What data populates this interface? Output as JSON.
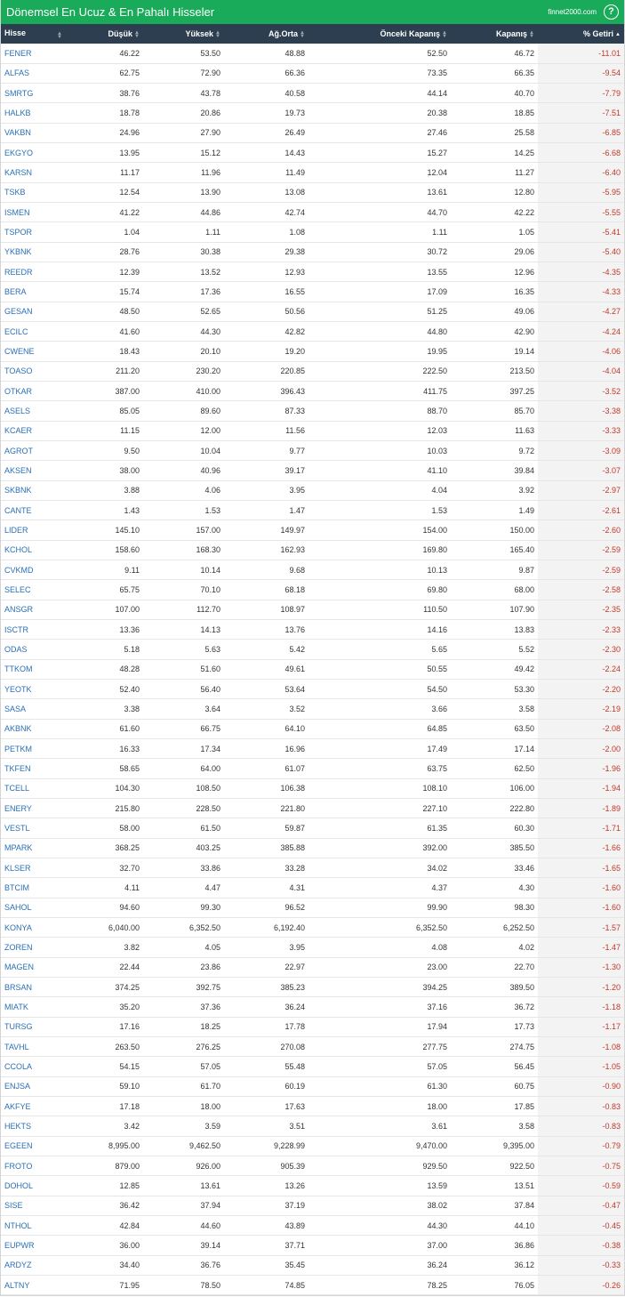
{
  "header": {
    "title": "Dönemsel En Ucuz & En Pahalı Hisseler",
    "brand": "finnet2000.com",
    "help_label": "?"
  },
  "colors": {
    "header_bg": "#1aab5a",
    "table_header_bg": "#2d3e50",
    "symbol": "#2a6fb5",
    "negative": "#c0392b"
  },
  "columns": [
    "Hisse",
    "Düşük",
    "Yüksek",
    "Ağ.Orta",
    "Önceki Kapanış",
    "Kapanış",
    "% Getiri"
  ],
  "rows": [
    [
      "FENER",
      "46.22",
      "53.50",
      "48.88",
      "52.50",
      "46.72",
      "-11.01"
    ],
    [
      "ALFAS",
      "62.75",
      "72.90",
      "66.36",
      "73.35",
      "66.35",
      "-9.54"
    ],
    [
      "SMRTG",
      "38.76",
      "43.78",
      "40.58",
      "44.14",
      "40.70",
      "-7.79"
    ],
    [
      "HALKB",
      "18.78",
      "20.86",
      "19.73",
      "20.38",
      "18.85",
      "-7.51"
    ],
    [
      "VAKBN",
      "24.96",
      "27.90",
      "26.49",
      "27.46",
      "25.58",
      "-6.85"
    ],
    [
      "EKGYO",
      "13.95",
      "15.12",
      "14.43",
      "15.27",
      "14.25",
      "-6.68"
    ],
    [
      "KARSN",
      "11.17",
      "11.96",
      "11.49",
      "12.04",
      "11.27",
      "-6.40"
    ],
    [
      "TSKB",
      "12.54",
      "13.90",
      "13.08",
      "13.61",
      "12.80",
      "-5.95"
    ],
    [
      "ISMEN",
      "41.22",
      "44.86",
      "42.74",
      "44.70",
      "42.22",
      "-5.55"
    ],
    [
      "TSPOR",
      "1.04",
      "1.11",
      "1.08",
      "1.11",
      "1.05",
      "-5.41"
    ],
    [
      "YKBNK",
      "28.76",
      "30.38",
      "29.38",
      "30.72",
      "29.06",
      "-5.40"
    ],
    [
      "REEDR",
      "12.39",
      "13.52",
      "12.93",
      "13.55",
      "12.96",
      "-4.35"
    ],
    [
      "BERA",
      "15.74",
      "17.36",
      "16.55",
      "17.09",
      "16.35",
      "-4.33"
    ],
    [
      "GESAN",
      "48.50",
      "52.65",
      "50.56",
      "51.25",
      "49.06",
      "-4.27"
    ],
    [
      "ECILC",
      "41.60",
      "44.30",
      "42.82",
      "44.80",
      "42.90",
      "-4.24"
    ],
    [
      "CWENE",
      "18.43",
      "20.10",
      "19.20",
      "19.95",
      "19.14",
      "-4.06"
    ],
    [
      "TOASO",
      "211.20",
      "230.20",
      "220.85",
      "222.50",
      "213.50",
      "-4.04"
    ],
    [
      "OTKAR",
      "387.00",
      "410.00",
      "396.43",
      "411.75",
      "397.25",
      "-3.52"
    ],
    [
      "ASELS",
      "85.05",
      "89.60",
      "87.33",
      "88.70",
      "85.70",
      "-3.38"
    ],
    [
      "KCAER",
      "11.15",
      "12.00",
      "11.56",
      "12.03",
      "11.63",
      "-3.33"
    ],
    [
      "AGROT",
      "9.50",
      "10.04",
      "9.77",
      "10.03",
      "9.72",
      "-3.09"
    ],
    [
      "AKSEN",
      "38.00",
      "40.96",
      "39.17",
      "41.10",
      "39.84",
      "-3.07"
    ],
    [
      "SKBNK",
      "3.88",
      "4.06",
      "3.95",
      "4.04",
      "3.92",
      "-2.97"
    ],
    [
      "CANTE",
      "1.43",
      "1.53",
      "1.47",
      "1.53",
      "1.49",
      "-2.61"
    ],
    [
      "LIDER",
      "145.10",
      "157.00",
      "149.97",
      "154.00",
      "150.00",
      "-2.60"
    ],
    [
      "KCHOL",
      "158.60",
      "168.30",
      "162.93",
      "169.80",
      "165.40",
      "-2.59"
    ],
    [
      "CVKMD",
      "9.11",
      "10.14",
      "9.68",
      "10.13",
      "9.87",
      "-2.59"
    ],
    [
      "SELEC",
      "65.75",
      "70.10",
      "68.18",
      "69.80",
      "68.00",
      "-2.58"
    ],
    [
      "ANSGR",
      "107.00",
      "112.70",
      "108.97",
      "110.50",
      "107.90",
      "-2.35"
    ],
    [
      "ISCTR",
      "13.36",
      "14.13",
      "13.76",
      "14.16",
      "13.83",
      "-2.33"
    ],
    [
      "ODAS",
      "5.18",
      "5.63",
      "5.42",
      "5.65",
      "5.52",
      "-2.30"
    ],
    [
      "TTKOM",
      "48.28",
      "51.60",
      "49.61",
      "50.55",
      "49.42",
      "-2.24"
    ],
    [
      "YEOTK",
      "52.40",
      "56.40",
      "53.64",
      "54.50",
      "53.30",
      "-2.20"
    ],
    [
      "SASA",
      "3.38",
      "3.64",
      "3.52",
      "3.66",
      "3.58",
      "-2.19"
    ],
    [
      "AKBNK",
      "61.60",
      "66.75",
      "64.10",
      "64.85",
      "63.50",
      "-2.08"
    ],
    [
      "PETKM",
      "16.33",
      "17.34",
      "16.96",
      "17.49",
      "17.14",
      "-2.00"
    ],
    [
      "TKFEN",
      "58.65",
      "64.00",
      "61.07",
      "63.75",
      "62.50",
      "-1.96"
    ],
    [
      "TCELL",
      "104.30",
      "108.50",
      "106.38",
      "108.10",
      "106.00",
      "-1.94"
    ],
    [
      "ENERY",
      "215.80",
      "228.50",
      "221.80",
      "227.10",
      "222.80",
      "-1.89"
    ],
    [
      "VESTL",
      "58.00",
      "61.50",
      "59.87",
      "61.35",
      "60.30",
      "-1.71"
    ],
    [
      "MPARK",
      "368.25",
      "403.25",
      "385.88",
      "392.00",
      "385.50",
      "-1.66"
    ],
    [
      "KLSER",
      "32.70",
      "33.86",
      "33.28",
      "34.02",
      "33.46",
      "-1.65"
    ],
    [
      "BTCIM",
      "4.11",
      "4.47",
      "4.31",
      "4.37",
      "4.30",
      "-1.60"
    ],
    [
      "SAHOL",
      "94.60",
      "99.30",
      "96.52",
      "99.90",
      "98.30",
      "-1.60"
    ],
    [
      "KONYA",
      "6,040.00",
      "6,352.50",
      "6,192.40",
      "6,352.50",
      "6,252.50",
      "-1.57"
    ],
    [
      "ZOREN",
      "3.82",
      "4.05",
      "3.95",
      "4.08",
      "4.02",
      "-1.47"
    ],
    [
      "MAGEN",
      "22.44",
      "23.86",
      "22.97",
      "23.00",
      "22.70",
      "-1.30"
    ],
    [
      "BRSAN",
      "374.25",
      "392.75",
      "385.23",
      "394.25",
      "389.50",
      "-1.20"
    ],
    [
      "MIATK",
      "35.20",
      "37.36",
      "36.24",
      "37.16",
      "36.72",
      "-1.18"
    ],
    [
      "TURSG",
      "17.16",
      "18.25",
      "17.78",
      "17.94",
      "17.73",
      "-1.17"
    ],
    [
      "TAVHL",
      "263.50",
      "276.25",
      "270.08",
      "277.75",
      "274.75",
      "-1.08"
    ],
    [
      "CCOLA",
      "54.15",
      "57.05",
      "55.48",
      "57.05",
      "56.45",
      "-1.05"
    ],
    [
      "ENJSA",
      "59.10",
      "61.70",
      "60.19",
      "61.30",
      "60.75",
      "-0.90"
    ],
    [
      "AKFYE",
      "17.18",
      "18.00",
      "17.63",
      "18.00",
      "17.85",
      "-0.83"
    ],
    [
      "HEKTS",
      "3.42",
      "3.59",
      "3.51",
      "3.61",
      "3.58",
      "-0.83"
    ],
    [
      "EGEEN",
      "8,995.00",
      "9,462.50",
      "9,228.99",
      "9,470.00",
      "9,395.00",
      "-0.79"
    ],
    [
      "FROTO",
      "879.00",
      "926.00",
      "905.39",
      "929.50",
      "922.50",
      "-0.75"
    ],
    [
      "DOHOL",
      "12.85",
      "13.61",
      "13.26",
      "13.59",
      "13.51",
      "-0.59"
    ],
    [
      "SISE",
      "36.42",
      "37.94",
      "37.19",
      "38.02",
      "37.84",
      "-0.47"
    ],
    [
      "NTHOL",
      "42.84",
      "44.60",
      "43.89",
      "44.30",
      "44.10",
      "-0.45"
    ],
    [
      "EUPWR",
      "36.00",
      "39.14",
      "37.71",
      "37.00",
      "36.86",
      "-0.38"
    ],
    [
      "ARDYZ",
      "34.40",
      "36.76",
      "35.45",
      "36.24",
      "36.12",
      "-0.33"
    ],
    [
      "ALTNY",
      "71.95",
      "78.50",
      "74.85",
      "78.25",
      "76.05",
      "-0.26"
    ]
  ]
}
